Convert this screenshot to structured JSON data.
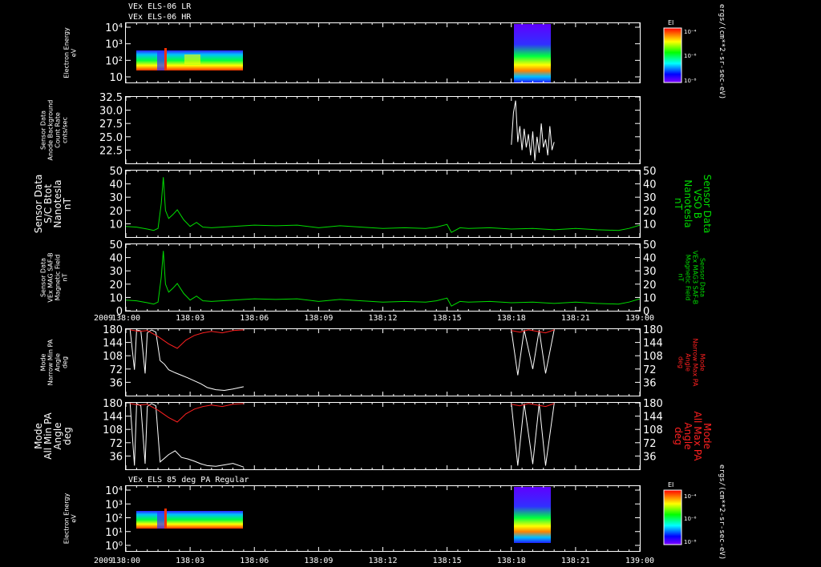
{
  "header": {
    "line1": "VEx ELS-06 LR",
    "line2": "VEx ELS-06 HR",
    "bottom_title": "VEx ELS 85 deg PA Regular",
    "year_label": "2009"
  },
  "colorbar": {
    "title": "EI",
    "units": "ergs/(cm**2-sr-sec-eV)",
    "ticks": [
      "10⁻⁴",
      "10⁻⁶",
      "10⁻⁸"
    ]
  },
  "time_axis": {
    "ticks": [
      "138:00",
      "138:03",
      "138:06",
      "138:09",
      "138:12",
      "138:15",
      "138:18",
      "138:21",
      "139:00"
    ]
  },
  "colors": {
    "white_trace": "#ffffff",
    "green_trace": "#00dd00",
    "red_trace": "#ff2020",
    "axis": "#ffffff"
  },
  "chart_data": [
    {
      "type": "heatmap",
      "panel": "energy_spectrogram_top",
      "ylabel": [
        "Electron Energy",
        "eV"
      ],
      "yticks": [
        "10⁴",
        "10³",
        "10²",
        "10"
      ],
      "scale": "log",
      "data_intervals": [
        [
          "138:00",
          "138:05.5"
        ],
        [
          "138:18",
          "138:20"
        ]
      ]
    },
    {
      "type": "line",
      "panel": "anode_background",
      "ylabel": [
        "Sensor Data",
        "Anode Background",
        "Count Rate",
        "cnts/sec"
      ],
      "ylim": [
        20,
        32.5
      ],
      "yticks": [
        "32.5",
        "30.0",
        "27.5",
        "25.0",
        "22.5"
      ],
      "series": [
        {
          "x": [
            18.0,
            18.1,
            18.2,
            18.3,
            18.4,
            18.5,
            18.6,
            18.7,
            18.8,
            18.9,
            19.0,
            19.1,
            19.2,
            19.3,
            19.4,
            19.5,
            19.6,
            19.7,
            19.8,
            19.9,
            20.0
          ],
          "values": [
            23.5,
            29.5,
            31.8,
            24.0,
            27.0,
            22.5,
            26.5,
            23.0,
            25.5,
            21.5,
            26.0,
            20.5,
            25.0,
            22.0,
            27.5,
            23.0,
            24.5,
            21.5,
            27.0,
            22.5,
            24.0
          ]
        }
      ]
    },
    {
      "type": "line",
      "panel": "sc_bfield",
      "ylabel": [
        "Sensor Data",
        "S/C Btot",
        "Nanotesla",
        "nT"
      ],
      "ylabel_right": [
        "Sensor Data",
        "VSO B",
        "Nanotesla",
        "nT"
      ],
      "ylim": [
        0,
        50
      ],
      "yticks": [
        "50",
        "40",
        "30",
        "20",
        "10"
      ],
      "series": [
        {
          "x": [
            0.0,
            0.5,
            1.0,
            1.3,
            1.5,
            1.65,
            1.75,
            1.85,
            2.0,
            2.2,
            2.4,
            2.7,
            3.0,
            3.3,
            3.6,
            4.0,
            5.0,
            6.0,
            7.0,
            8.0,
            9.0,
            10.0,
            11.0,
            12.0,
            13.0,
            14.0,
            14.5,
            15.0,
            15.2,
            15.6,
            16.0,
            17.0,
            18.0,
            19.0,
            20.0,
            21.0,
            22.0,
            23.0,
            23.5,
            24.0
          ],
          "values": [
            8.0,
            7.5,
            6.0,
            5.0,
            6.5,
            25.0,
            45.0,
            20.0,
            14.0,
            17.0,
            20.5,
            13.0,
            8.0,
            11.0,
            7.5,
            7.0,
            8.0,
            9.0,
            8.5,
            9.0,
            7.0,
            8.5,
            7.5,
            6.5,
            7.0,
            6.5,
            7.5,
            9.5,
            3.5,
            7.0,
            6.5,
            7.0,
            6.0,
            6.5,
            5.5,
            6.5,
            5.5,
            5.0,
            6.5,
            9.0
          ]
        }
      ]
    },
    {
      "type": "line",
      "panel": "mag_field",
      "ylabel": [
        "Sensor Data",
        "VEx MAG SAF-B",
        "Magnetic Field",
        "nT"
      ],
      "ylabel_right": [
        "Sensor Data",
        "VEx MAG3 SAF-B",
        "Magnetic Field",
        "nT"
      ],
      "ylim": [
        0,
        50
      ],
      "yticks": [
        "50",
        "40",
        "30",
        "20",
        "10",
        "0"
      ],
      "series": [
        {
          "x": [
            0.0,
            0.5,
            1.0,
            1.3,
            1.5,
            1.65,
            1.75,
            1.85,
            2.0,
            2.2,
            2.4,
            2.7,
            3.0,
            3.3,
            3.6,
            4.0,
            5.0,
            6.0,
            7.0,
            8.0,
            9.0,
            10.0,
            11.0,
            12.0,
            13.0,
            14.0,
            14.5,
            15.0,
            15.2,
            15.6,
            16.0,
            17.0,
            18.0,
            19.0,
            20.0,
            21.0,
            22.0,
            23.0,
            23.5,
            24.0
          ],
          "values": [
            8.0,
            7.5,
            6.0,
            5.0,
            6.5,
            25.0,
            45.0,
            20.0,
            14.0,
            17.0,
            20.5,
            13.0,
            8.0,
            11.0,
            7.5,
            7.0,
            8.0,
            9.0,
            8.5,
            9.0,
            7.0,
            8.5,
            7.5,
            6.5,
            7.0,
            6.5,
            7.5,
            9.5,
            3.5,
            7.0,
            6.5,
            7.0,
            6.0,
            6.5,
            5.5,
            6.5,
            5.5,
            5.0,
            6.5,
            9.0
          ]
        }
      ]
    },
    {
      "type": "line",
      "panel": "narrow_mode_pa",
      "ylabel": [
        "Mode",
        "Narrow Min PA",
        "Angle",
        "deg"
      ],
      "ylabel_right": [
        "Mode",
        "Narrow Max PA",
        "Angle",
        "deg"
      ],
      "ylim": [
        0,
        180
      ],
      "yticks": [
        "180",
        "144",
        "108",
        "72",
        "36"
      ],
      "series": [
        {
          "name": "Min PA",
          "x": [
            0.2,
            0.4,
            0.5,
            0.7,
            0.9,
            1.0,
            1.2,
            1.4,
            1.6,
            1.8,
            2.0,
            2.3,
            2.6,
            2.9,
            3.2,
            3.5,
            3.8,
            4.2,
            4.6,
            5.0,
            5.5,
            18.0,
            18.3,
            18.6,
            19.0,
            19.3,
            19.6,
            20.0
          ],
          "values": [
            178,
            70,
            178,
            175,
            60,
            170,
            178,
            172,
            95,
            85,
            70,
            62,
            55,
            48,
            40,
            32,
            22,
            16,
            14,
            18,
            24,
            178,
            55,
            178,
            72,
            178,
            60,
            178
          ]
        },
        {
          "name": "Max PA",
          "x": [
            0.2,
            0.6,
            1.0,
            1.5,
            2.0,
            2.4,
            2.8,
            3.2,
            3.6,
            4.0,
            4.5,
            5.0,
            5.5,
            18.0,
            18.4,
            18.8,
            19.2,
            19.6,
            20.0
          ],
          "values": [
            178,
            174,
            176,
            160,
            140,
            128,
            150,
            163,
            170,
            174,
            170,
            176,
            178,
            176,
            172,
            178,
            174,
            170,
            178
          ]
        }
      ]
    },
    {
      "type": "line",
      "panel": "all_mode_pa",
      "ylabel": [
        "Mode",
        "All Min PA",
        "Angle",
        "deg"
      ],
      "ylabel_right": [
        "Mode",
        "All Max PA",
        "Angle",
        "deg"
      ],
      "ylim": [
        0,
        180
      ],
      "yticks": [
        "180",
        "144",
        "108",
        "72",
        "36"
      ],
      "series": [
        {
          "name": "Min PA",
          "x": [
            0.2,
            0.4,
            0.5,
            0.7,
            0.9,
            1.0,
            1.2,
            1.4,
            1.6,
            1.8,
            2.0,
            2.3,
            2.6,
            2.9,
            3.2,
            3.5,
            3.8,
            4.2,
            4.6,
            5.0,
            5.5,
            18.0,
            18.3,
            18.6,
            19.0,
            19.3,
            19.6,
            20.0
          ],
          "values": [
            178,
            10,
            178,
            172,
            15,
            170,
            178,
            172,
            20,
            30,
            40,
            50,
            32,
            28,
            22,
            15,
            10,
            8,
            12,
            16,
            6,
            178,
            10,
            178,
            14,
            178,
            10,
            178
          ]
        },
        {
          "name": "Max PA",
          "x": [
            0.2,
            0.6,
            1.0,
            1.5,
            2.0,
            2.4,
            2.8,
            3.2,
            3.6,
            4.0,
            4.5,
            5.0,
            5.5,
            18.0,
            18.4,
            18.8,
            19.2,
            19.6,
            20.0
          ],
          "values": [
            178,
            174,
            176,
            160,
            140,
            128,
            150,
            163,
            170,
            174,
            170,
            176,
            178,
            176,
            172,
            178,
            174,
            170,
            178
          ]
        }
      ]
    },
    {
      "type": "heatmap",
      "panel": "energy_spectrogram_85deg",
      "ylabel": [
        "Electron Energy",
        "eV"
      ],
      "yticks": [
        "10⁴",
        "10³",
        "10²",
        "10¹",
        "10⁰"
      ],
      "scale": "log",
      "data_intervals": [
        [
          "138:00",
          "138:05.5"
        ],
        [
          "138:18",
          "138:20"
        ]
      ]
    }
  ]
}
